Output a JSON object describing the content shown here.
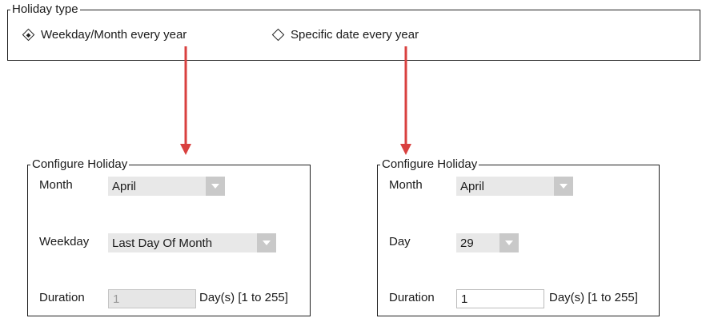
{
  "holiday_type": {
    "legend": "Holiday type",
    "options": [
      {
        "label": "Weekday/Month every year",
        "checked": true,
        "icon": "diamond-radio-checked-icon"
      },
      {
        "label": "Specific date every year",
        "checked": false,
        "icon": "diamond-radio-unchecked-icon"
      }
    ]
  },
  "left_panel": {
    "legend": "Configure Holiday",
    "month_label": "Month",
    "month_value": "April",
    "weekday_label": "Weekday",
    "weekday_value": "Last Day Of Month",
    "duration_label": "Duration",
    "duration_value": "1",
    "duration_hint": "Day(s) [1 to 255]"
  },
  "right_panel": {
    "legend": "Configure Holiday",
    "month_label": "Month",
    "month_value": "April",
    "day_label": "Day",
    "day_value": "29",
    "duration_label": "Duration",
    "duration_value": "1",
    "duration_hint": "Day(s) [1 to 255]"
  },
  "colors": {
    "annotation_arrow": "#d9403f",
    "dropdown_field": "#e8e8e8",
    "dropdown_button": "#c9c9c9",
    "border": "#1f1f1f"
  },
  "icons": {
    "dropdown": "chevron-down-icon",
    "annotation": "red-arrow-down-icon"
  }
}
